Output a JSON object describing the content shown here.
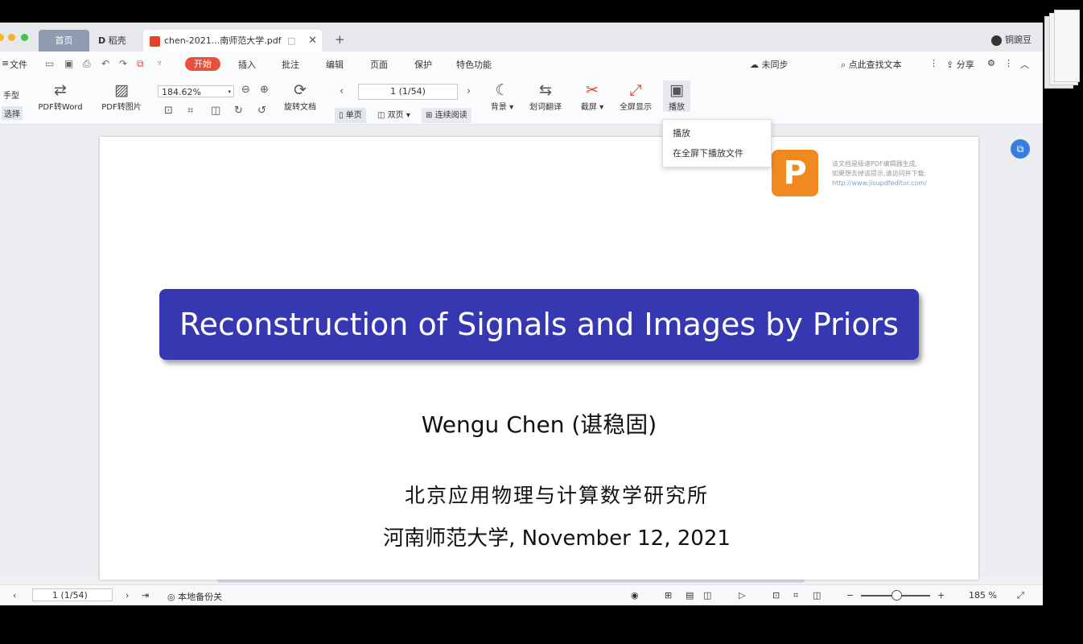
{
  "tabs": {
    "home": "首页",
    "daoke": "稻壳",
    "pdf": "chen-2021...南师范大学.pdf",
    "daoke_mark": "D",
    "close_icon": "✕",
    "new_tab": "+"
  },
  "user": {
    "name": "铜豌豆"
  },
  "menu": {
    "file": "文件",
    "start": "开始",
    "insert": "插入",
    "comment": "批注",
    "edit": "编辑",
    "page": "页面",
    "protect": "保护",
    "special": "特色功能",
    "sync": "未同步",
    "search": "点此查找文本",
    "share": "分享"
  },
  "toolbar": {
    "hand": "手型",
    "select": "选择",
    "pdf_to_word": "PDF转Word",
    "pdf_to_image": "PDF转图片",
    "zoom": "184.62%",
    "rotate_doc": "旋转文档",
    "page_indicator": "1 (1/54)",
    "single": "单页",
    "double": "双页",
    "continuous": "连续阅读",
    "background": "背景",
    "translate": "划词翻译",
    "screenshot": "截屏",
    "fullscreen": "全屏显示",
    "play": "播放"
  },
  "dropdown": {
    "item1": "播放",
    "item2": "在全屏下播放文件"
  },
  "document": {
    "title": "Reconstruction of Signals and Images by Priors",
    "author": "Wengu Chen (谌稳固)",
    "institute": "北京应用物理与计算数学研究所",
    "place_date": "河南师范大学, November 12, 2021",
    "watermark_line1": "该文档是极速PDF编辑器生成,",
    "watermark_line2": "如果想去掉该提示,请访问并下载:",
    "watermark_link": "http://www.jisupdfeditor.com/"
  },
  "statusbar": {
    "page": "1 (1/54)",
    "backup": "本地备份关",
    "zoom": "185 %"
  },
  "colors": {
    "title_box": "#3538b0",
    "start_button": "#e9513c",
    "tab_home": "#8e9bb0"
  }
}
